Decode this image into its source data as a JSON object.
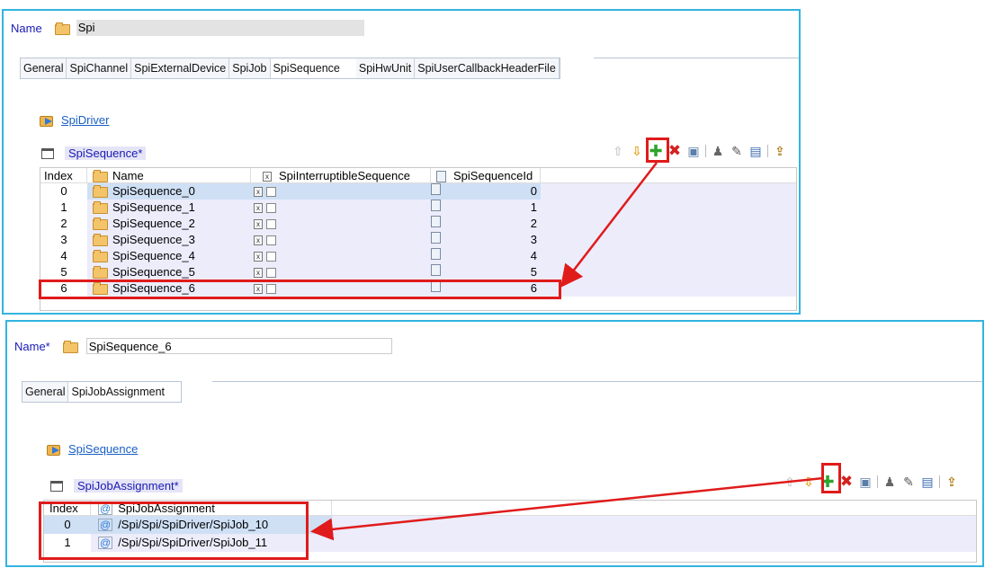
{
  "panel1": {
    "name_label": "Name",
    "name_value": "Spi",
    "tabs": [
      "General",
      "SpiChannel",
      "SpiExternalDevice",
      "SpiJob",
      "SpiSequence",
      "SpiHwUnit",
      "SpiUserCallbackHeaderFile"
    ],
    "active_tab_index": 4,
    "link": "SpiDriver",
    "section_title": "SpiSequence*",
    "columns": {
      "index": "Index",
      "name": "Name",
      "interruptible": "SpiInterruptibleSequence",
      "seqid": "SpiSequenceId"
    },
    "rows": [
      {
        "index": "0",
        "name": "SpiSequence_0",
        "seqid": "0"
      },
      {
        "index": "1",
        "name": "SpiSequence_1",
        "seqid": "1"
      },
      {
        "index": "2",
        "name": "SpiSequence_2",
        "seqid": "2"
      },
      {
        "index": "3",
        "name": "SpiSequence_3",
        "seqid": "3"
      },
      {
        "index": "4",
        "name": "SpiSequence_4",
        "seqid": "4"
      },
      {
        "index": "5",
        "name": "SpiSequence_5",
        "seqid": "5"
      },
      {
        "index": "6",
        "name": "SpiSequence_6",
        "seqid": "6"
      }
    ]
  },
  "panel2": {
    "name_label": "Name*",
    "name_value": "SpiSequence_6",
    "tabs": [
      "General",
      "SpiJobAssignment"
    ],
    "active_tab_index": 1,
    "link": "SpiSequence",
    "section_title": "SpiJobAssignment*",
    "columns": {
      "index": "Index",
      "assignment": "SpiJobAssignment"
    },
    "rows": [
      {
        "index": "0",
        "value": "/Spi/Spi/SpiDriver/SpiJob_10"
      },
      {
        "index": "1",
        "value": "/Spi/Spi/SpiDriver/SpiJob_11"
      }
    ]
  },
  "toolbar_icons": [
    "move-up-icon",
    "move-down-icon",
    "add-icon",
    "delete-icon",
    "copy-icon",
    "person-icon",
    "pencil-icon",
    "edit-table-icon",
    "import-icon"
  ],
  "colors": {
    "panel_border": "#33b4e0",
    "highlight_red": "#e01b1b",
    "label_blue": "#1a1ab5",
    "link_blue": "#1a5fc4",
    "row_shade": "#ececfb"
  }
}
